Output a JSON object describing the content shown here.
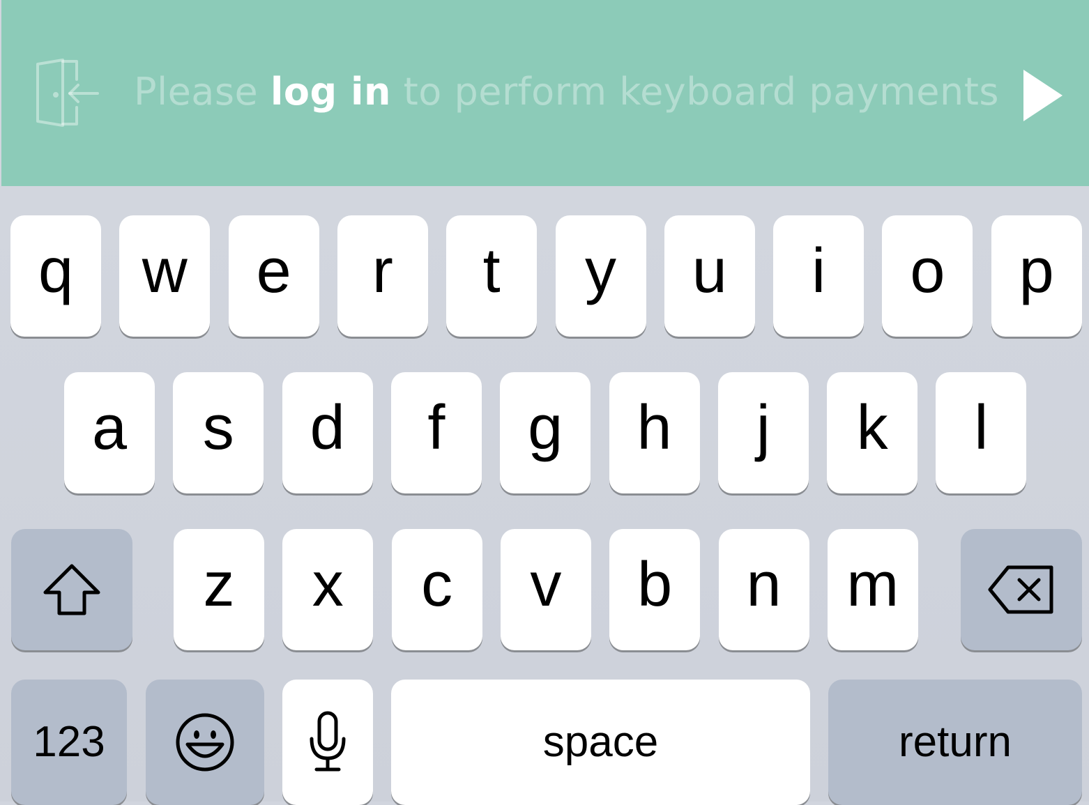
{
  "banner": {
    "message_pre": "Please ",
    "message_link": "log in",
    "message_post": " to perform keyboard payments",
    "login_icon": "door-login-icon",
    "action_icon": "play-icon",
    "background": "#8ccbb8"
  },
  "keyboard": {
    "row1": [
      "q",
      "w",
      "e",
      "r",
      "t",
      "y",
      "u",
      "i",
      "o",
      "p"
    ],
    "row2": [
      "a",
      "s",
      "d",
      "f",
      "g",
      "h",
      "j",
      "k",
      "l"
    ],
    "row3": [
      "z",
      "x",
      "c",
      "v",
      "b",
      "n",
      "m"
    ],
    "shift_icon": "shift-arrow-icon",
    "delete_icon": "backspace-icon",
    "numbers_label": "123",
    "emoji_icon": "emoji-smiley-icon",
    "mic_icon": "microphone-icon",
    "space_label": "space",
    "return_label": "return"
  }
}
